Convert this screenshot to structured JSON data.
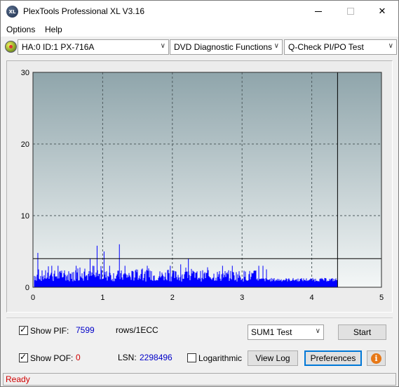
{
  "window": {
    "title": "PlexTools Professional XL V3.16",
    "app_icon_text": "XL",
    "controls": [
      "minimize-icon",
      "maximize-icon",
      "close-icon"
    ]
  },
  "menu": {
    "items": [
      {
        "label": "Options"
      },
      {
        "label": "Help"
      }
    ]
  },
  "toolbar": {
    "drive": "HA:0 ID:1  PX-716A",
    "function": "DVD Diagnostic Functions",
    "test": "Q-Check PI/PO Test",
    "dropdown_arrow": "∨"
  },
  "chart_data": {
    "type": "bar",
    "title": "",
    "xlabel": "",
    "ylabel": "",
    "xlim": [
      0,
      5
    ],
    "ylim": [
      0,
      30
    ],
    "x_ticks": [
      "0",
      "1",
      "2",
      "3",
      "4",
      "5"
    ],
    "y_ticks": [
      "0",
      "10",
      "20",
      "30"
    ],
    "grid": true,
    "background_top": "#8fa5ab",
    "background_bottom": "#f4f7f7",
    "bar_color": "#0000ff",
    "end_marker_x": 4.37,
    "threshold_y": 4,
    "series": [
      {
        "values_x_start": 0.02,
        "values_x_end": 4.37,
        "baseline_approx": 0.8,
        "typical_range": [
          1,
          2
        ],
        "peaks": [
          {
            "x": 0.07,
            "y": 4.8
          },
          {
            "x": 0.27,
            "y": 3
          },
          {
            "x": 0.36,
            "y": 3
          },
          {
            "x": 0.62,
            "y": 3
          },
          {
            "x": 0.82,
            "y": 4
          },
          {
            "x": 0.86,
            "y": 3
          },
          {
            "x": 0.92,
            "y": 5.8
          },
          {
            "x": 1.02,
            "y": 5
          },
          {
            "x": 1.1,
            "y": 3
          },
          {
            "x": 1.24,
            "y": 6
          },
          {
            "x": 1.32,
            "y": 3
          },
          {
            "x": 1.48,
            "y": 2.5
          },
          {
            "x": 1.64,
            "y": 3
          },
          {
            "x": 1.97,
            "y": 3
          },
          {
            "x": 2.12,
            "y": 3.2
          },
          {
            "x": 2.23,
            "y": 4
          },
          {
            "x": 2.72,
            "y": 3
          },
          {
            "x": 2.86,
            "y": 3
          },
          {
            "x": 3.24,
            "y": 3
          },
          {
            "x": 3.3,
            "y": 3
          },
          {
            "x": 3.35,
            "y": 2.5
          }
        ]
      }
    ]
  },
  "controls": {
    "show_pif": {
      "label": "Show PIF:",
      "checked": true,
      "value": "7599",
      "unit": "rows/1ECC"
    },
    "show_pof": {
      "label": "Show POF:",
      "checked": true,
      "value": "0"
    },
    "lsn_label": "LSN:",
    "lsn_value": "2298496",
    "logarithmic": {
      "label": "Logarithmic",
      "checked": false
    },
    "sum_select": "SUM1 Test",
    "start_button": "Start",
    "view_log_button": "View Log",
    "preferences_button": "Preferences",
    "info_glyph": "i"
  },
  "status": {
    "text": "Ready"
  }
}
